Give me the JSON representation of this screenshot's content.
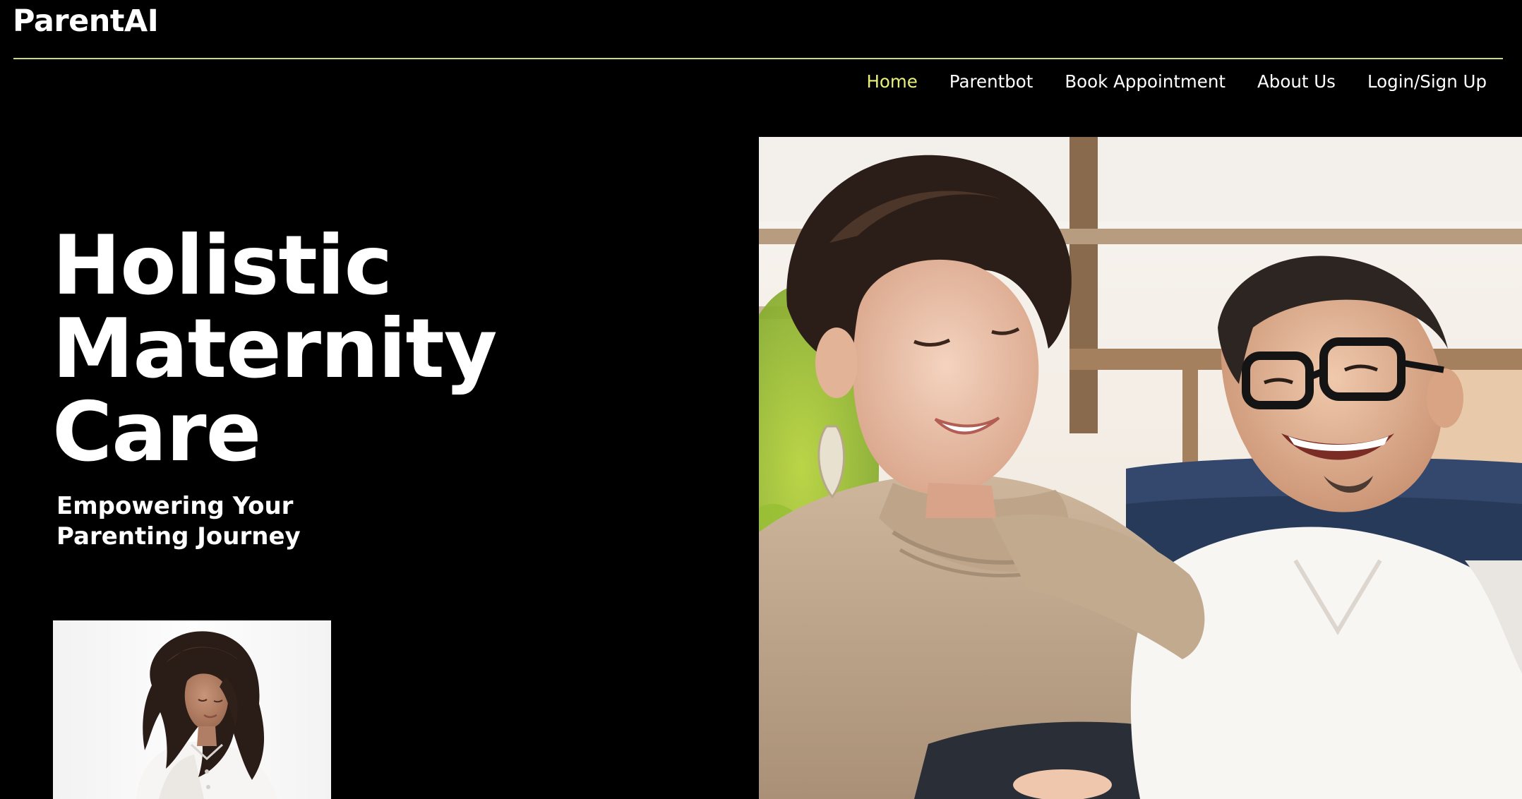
{
  "brand": {
    "logo_text": "ParentAI"
  },
  "nav": {
    "items": [
      {
        "label": "Home",
        "active": true
      },
      {
        "label": "Parentbot",
        "active": false
      },
      {
        "label": "Book Appointment",
        "active": false
      },
      {
        "label": "About Us",
        "active": false
      },
      {
        "label": "Login/Sign Up",
        "active": false
      }
    ]
  },
  "hero": {
    "title_lines": [
      "Holistic",
      "Maternity",
      "Care"
    ],
    "subtitle_lines": [
      "Empowering Your",
      "Parenting Journey"
    ]
  },
  "images": {
    "small_photo": "pregnant-woman-photo",
    "main_photo": "smiling-couple-photo"
  },
  "colors": {
    "background": "#000000",
    "text": "#ffffff",
    "nav_active": "#e8f07a",
    "divider": "#c7d98e"
  }
}
